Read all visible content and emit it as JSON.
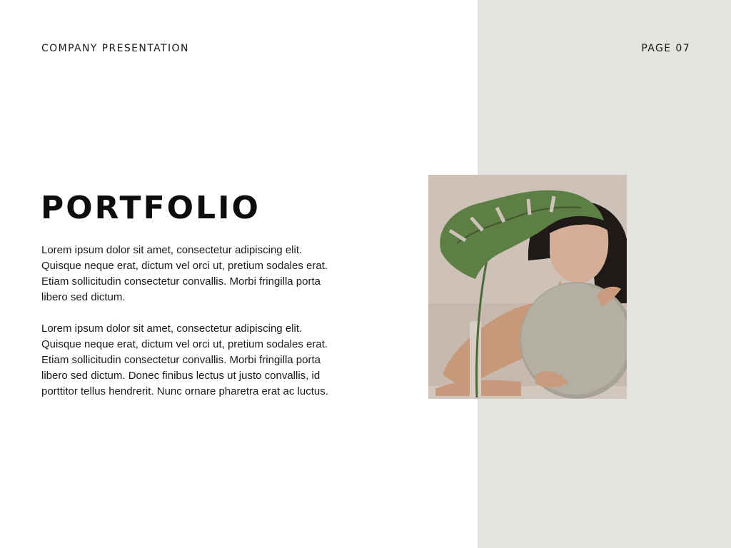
{
  "header": {
    "left_label": "COMPANY PRESENTATION",
    "page_label": "PAGE 07"
  },
  "main": {
    "title": "PORTFOLIO",
    "paragraphs": [
      "Lorem ipsum dolor sit amet, consectetur adipiscing elit.\nQuisque neque erat, dictum vel orci ut, pretium sodales erat.\nEtiam sollicitudin consectetur convallis. Morbi fringilla porta\nlibero sed dictum.",
      "Lorem ipsum dolor sit amet, consectetur adipiscing elit.\nQuisque neque erat, dictum vel orci ut, pretium sodales erat.\nEtiam sollicitudin consectetur convallis. Morbi fringilla porta\nlibero sed dictum. Donec finibus lectus ut justo convallis, id\nporttitor tellus hendrerit. Nunc ornare pharetra erat ac luctus."
    ]
  },
  "colors": {
    "side_panel": "#e3e3df",
    "text": "#111111",
    "photo_background": "#cbbfb6"
  }
}
